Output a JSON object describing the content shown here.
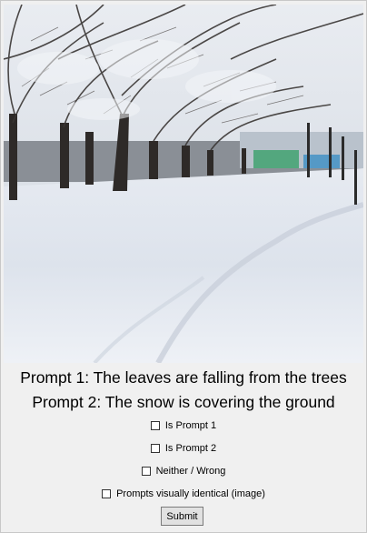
{
  "image": {
    "description_icon": "snowy-park-photo"
  },
  "prompts": {
    "prompt1": "Prompt 1: The leaves are falling from the trees",
    "prompt2": "Prompt 2: The snow is covering the ground"
  },
  "options": [
    {
      "label": "Is Prompt 1",
      "checked": false
    },
    {
      "label": "Is Prompt 2",
      "checked": false
    },
    {
      "label": "Neither / Wrong",
      "checked": false
    },
    {
      "label": "Prompts visually identical (image)",
      "checked": false
    }
  ],
  "submit_label": "Submit"
}
